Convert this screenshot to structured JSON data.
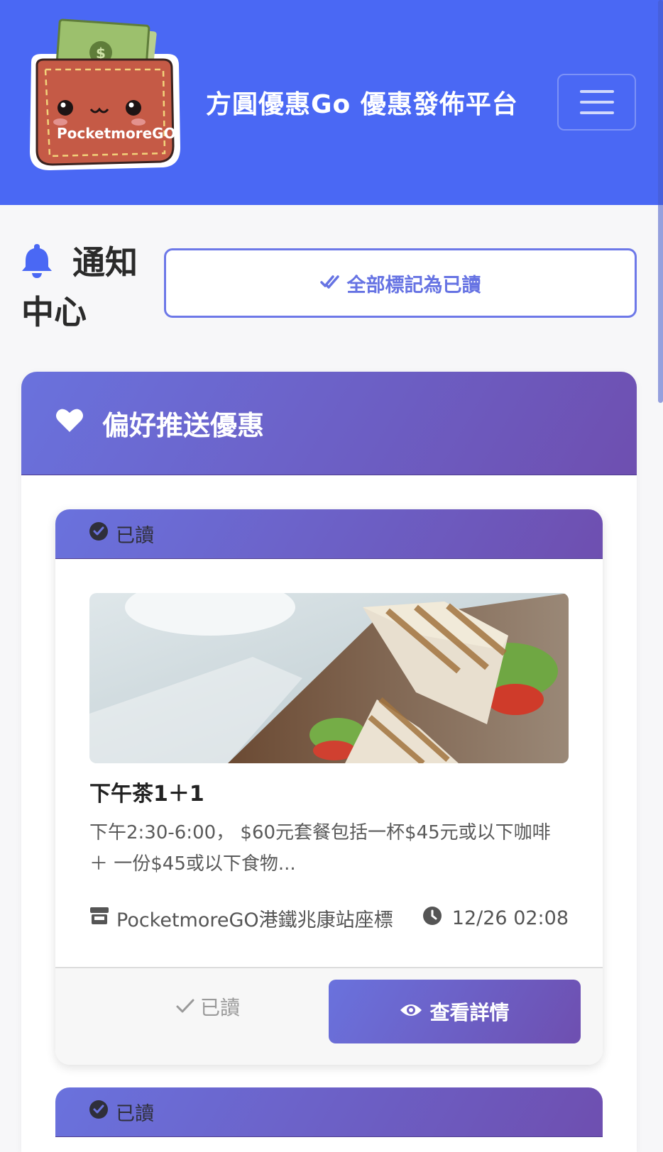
{
  "header": {
    "logo_text": "PocketmoreGO",
    "title": "方圓優惠Go 優惠發佈平台",
    "menu_icon": "hamburger-icon",
    "bg_color": "#4a68f4"
  },
  "page": {
    "title": "通知中心",
    "title_icon": "bell-icon",
    "mark_all_label": "全部標記為已讀"
  },
  "section": {
    "title": "偏好推送優惠",
    "icon": "heart-icon"
  },
  "notifications": [
    {
      "status": "已讀",
      "title": "下午茶1＋1",
      "description": "下午2:30-6:00， $60元套餐包括一杯$45元或以下咖啡 ＋ 一份$45或以下食物...",
      "store": "PocketmoreGO港鐵兆康站座標",
      "time": "12/26 02:08",
      "read_button": "已讀",
      "detail_button": "查看詳情"
    },
    {
      "status": "已讀"
    }
  ],
  "colors": {
    "accent": "#4a68f4",
    "gradient_start": "#6a72dd",
    "gradient_end": "#6e4fb0"
  }
}
